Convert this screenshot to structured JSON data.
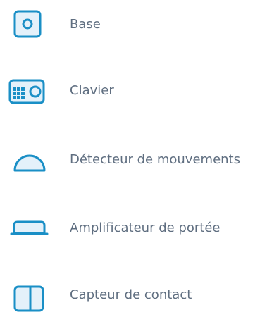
{
  "colors": {
    "icon_stroke": "#1a8fc6",
    "icon_fill": "#e4f1fa",
    "label": "#5f6e80"
  },
  "devices": [
    {
      "label": "Base",
      "icon": "base-icon"
    },
    {
      "label": "Clavier",
      "icon": "keypad-icon"
    },
    {
      "label": "Détecteur de mouvements",
      "icon": "motion-sensor-icon"
    },
    {
      "label": "Amplificateur de portée",
      "icon": "range-extender-icon"
    },
    {
      "label": "Capteur de contact",
      "icon": "contact-sensor-icon"
    }
  ]
}
